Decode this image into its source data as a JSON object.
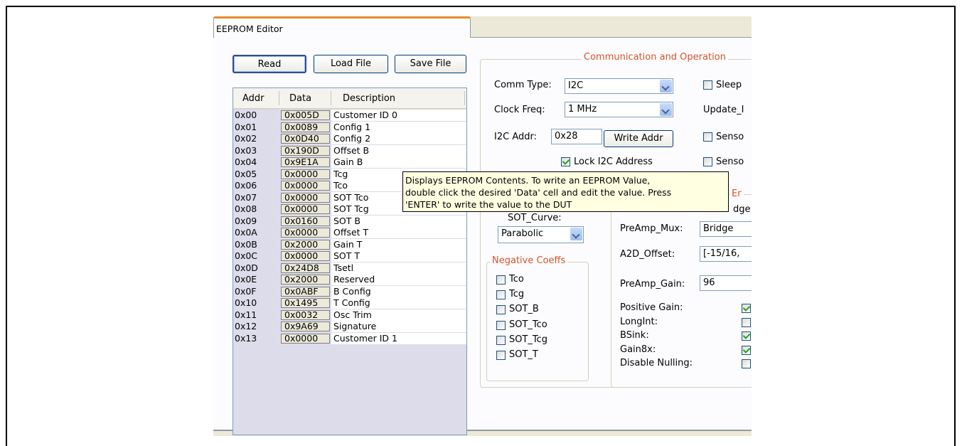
{
  "window": {
    "tab_title": "EEPROM Editor"
  },
  "buttons": {
    "read": "Read",
    "load_file": "Load File",
    "save_file": "Save File",
    "write_addr": "Write Addr"
  },
  "grid": {
    "headers": [
      "Addr",
      "Data",
      "Description"
    ],
    "rows": [
      {
        "addr": "0x00",
        "data": "0x005D",
        "desc": "Customer ID 0"
      },
      {
        "addr": "0x01",
        "data": "0x0089",
        "desc": "Config 1"
      },
      {
        "addr": "0x02",
        "data": "0x0D40",
        "desc": "Config 2"
      },
      {
        "addr": "0x03",
        "data": "0x190D",
        "desc": "Offset B"
      },
      {
        "addr": "0x04",
        "data": "0x9E1A",
        "desc": "Gain B"
      },
      {
        "addr": "0x05",
        "data": "0x0000",
        "desc": "Tcg"
      },
      {
        "addr": "0x06",
        "data": "0x0000",
        "desc": "Tco"
      },
      {
        "addr": "0x07",
        "data": "0x0000",
        "desc": "SOT Tco"
      },
      {
        "addr": "0x08",
        "data": "0x0000",
        "desc": "SOT Tcg"
      },
      {
        "addr": "0x09",
        "data": "0x0160",
        "desc": "SOT B"
      },
      {
        "addr": "0x0A",
        "data": "0x0000",
        "desc": "Offset T"
      },
      {
        "addr": "0x0B",
        "data": "0x2000",
        "desc": "Gain T"
      },
      {
        "addr": "0x0C",
        "data": "0x0000",
        "desc": "SOT T"
      },
      {
        "addr": "0x0D",
        "data": "0x24D8",
        "desc": "Tsetl"
      },
      {
        "addr": "0x0E",
        "data": "0x2000",
        "desc": "Reserved"
      },
      {
        "addr": "0x0F",
        "data": "0x0ABF",
        "desc": "B Config"
      },
      {
        "addr": "0x10",
        "data": "0x1495",
        "desc": "T Config"
      },
      {
        "addr": "0x11",
        "data": "0x0032",
        "desc": "Osc Trim"
      },
      {
        "addr": "0x12",
        "data": "0x9A69",
        "desc": "Signature"
      },
      {
        "addr": "0x13",
        "data": "0x0000",
        "desc": "Customer ID 1"
      }
    ]
  },
  "comm": {
    "group_title": "Communication and Operation",
    "comm_type_label": "Comm Type:",
    "comm_type_value": "I2C",
    "clock_freq_label": "Clock Freq:",
    "clock_freq_value": "1 MHz",
    "i2c_addr_label": "I2C Addr:",
    "i2c_addr_value": "0x28",
    "lock_label": "Lock I2C Address",
    "lock_checked": true,
    "sleep_label": "Sleep",
    "update_label": "Update_I",
    "sensor1_label": "Senso",
    "sensor2_label": "Senso"
  },
  "sot": {
    "curve_label": "SOT_Curve:",
    "curve_value": "Parabolic",
    "neg_title": "Negative Coeffs",
    "neg_items": [
      "Tco",
      "Tcg",
      "SOT_B",
      "SOT_Tco",
      "SOT_Tcg",
      "SOT_T"
    ]
  },
  "bridge": {
    "partial_title": "Er",
    "partial_value": "dge",
    "preamp_mux_label": "PreAmp_Mux:",
    "preamp_mux_value": "Bridge",
    "a2d_offset_label": "A2D_Offset:",
    "a2d_offset_value": "[-15/16,",
    "preamp_gain_label": "PreAmp_Gain:",
    "preamp_gain_value": "96",
    "flags": [
      {
        "label": "Positive Gain:",
        "checked": true
      },
      {
        "label": "LongInt:",
        "checked": false
      },
      {
        "label": "BSink:",
        "checked": true
      },
      {
        "label": "Gain8x:",
        "checked": true
      },
      {
        "label": "Disable Nulling:",
        "checked": false
      }
    ]
  },
  "tooltip": {
    "lines": [
      "Displays EEPROM Contents.  To write an EEPROM Value,",
      "double click the desired 'Data' cell and edit the value.  Press",
      "'ENTER' to write the value to the DUT"
    ]
  }
}
